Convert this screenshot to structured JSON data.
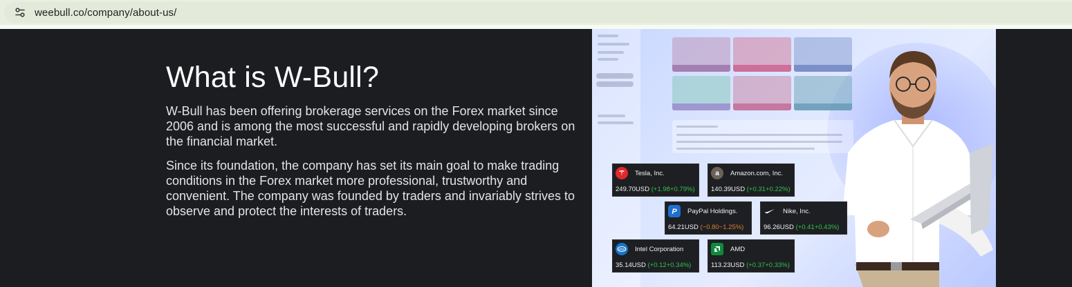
{
  "browser": {
    "url": "weebull.co/company/about-us/",
    "site_info_icon": "tune-icon"
  },
  "about": {
    "heading": "What is W-Bull?",
    "paragraph1": "W-Bull has been offering brokerage services on the Forex market since 2006 and is among the most successful and rapidly developing brokers on the financial market.",
    "paragraph2": "Since its foundation, the company has set its main goal to make trading conditions in the Forex market more professional, trustworthy and convenient. The company was founded by traders and invariably strives to observe and protect the interests of traders."
  },
  "stocks": [
    {
      "name": "Tesla, Inc.",
      "price": "249.70USD",
      "change": "(+1.98+0.79%)",
      "positive": true,
      "icon": "tesla-logo-icon",
      "color": "#e0292b"
    },
    {
      "name": "Amazon.com, Inc.",
      "price": "140.39USD",
      "change": "(+0.31+0.22%)",
      "positive": true,
      "icon": "amazon-logo-icon",
      "color": "#6b6158"
    },
    {
      "name": "PayPal Holdings.",
      "price": "64.21USD",
      "change": "(−0.80−1.25%)",
      "positive": false,
      "icon": "paypal-logo-icon",
      "color": "#1f6fd1"
    },
    {
      "name": "Nike, Inc.",
      "price": "96.26USD",
      "change": "(+0.41+0.43%)",
      "positive": true,
      "icon": "nike-logo-icon",
      "color": "#1d1f23"
    },
    {
      "name": "Intel Corporation",
      "price": "35.14USD",
      "change": "(+0.12+0.34%)",
      "positive": true,
      "icon": "intel-logo-icon",
      "color": "#1674c8"
    },
    {
      "name": "AMD",
      "price": "113.23USD",
      "change": "(+0.37+0.33%)",
      "positive": true,
      "icon": "amd-logo-icon",
      "color": "#0e8a3a"
    }
  ],
  "colors": {
    "page_background": "#1c1d21",
    "positive_change": "#33c24a",
    "negative_change": "#e07e2e"
  }
}
